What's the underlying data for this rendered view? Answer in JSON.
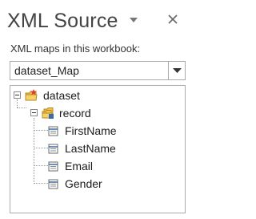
{
  "pane": {
    "title": "XML Source",
    "maps_label": "XML maps in this workbook:",
    "selected_map": "dataset_Map"
  },
  "tree": {
    "root": "dataset",
    "record": "record",
    "fields": [
      "FirstName",
      "LastName",
      "Email",
      "Gender"
    ]
  },
  "colors": {
    "border": "#ababab",
    "folder_yellow": "#f2c14e",
    "root_marker": "#e03c31",
    "field_icon_blue": "#3b6aa8"
  },
  "icons": {
    "menu": "chevron-down-icon",
    "close": "close-icon",
    "root": "root-element-icon",
    "record": "repeating-element-icon",
    "field": "element-field-icon"
  }
}
